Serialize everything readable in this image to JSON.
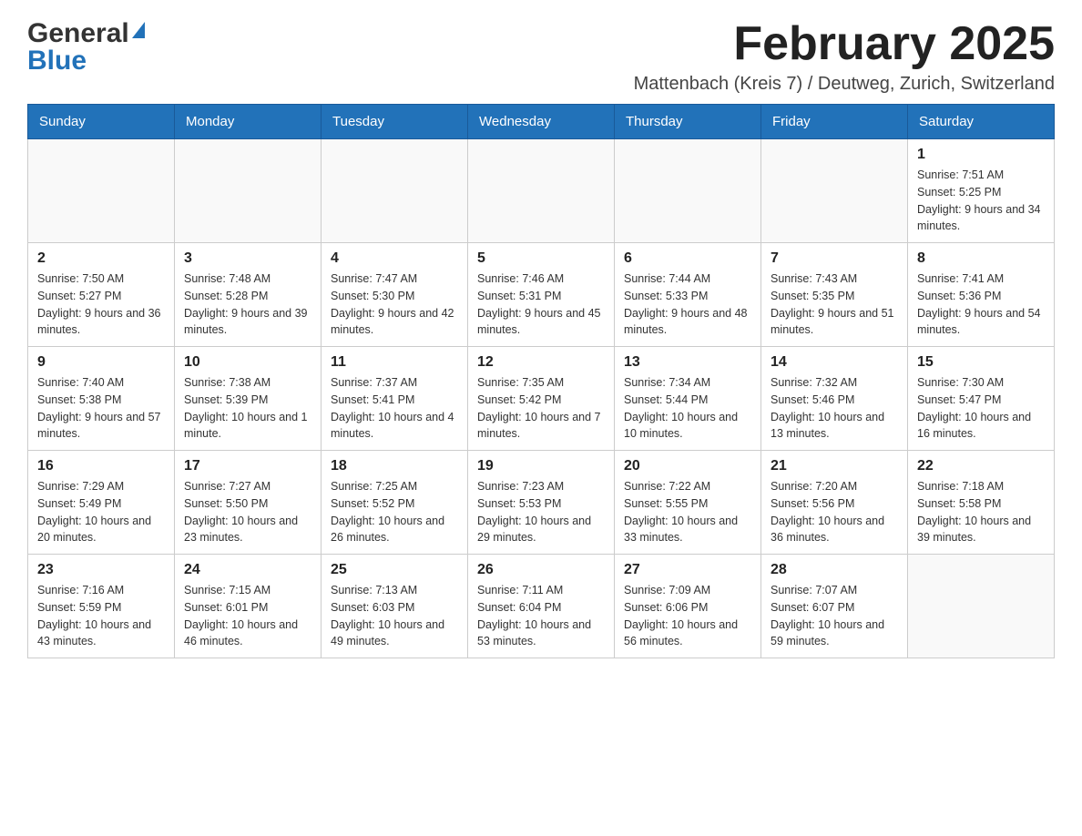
{
  "header": {
    "logo_general": "General",
    "logo_blue": "Blue",
    "month_title": "February 2025",
    "location": "Mattenbach (Kreis 7) / Deutweg, Zurich, Switzerland"
  },
  "weekdays": [
    "Sunday",
    "Monday",
    "Tuesday",
    "Wednesday",
    "Thursday",
    "Friday",
    "Saturday"
  ],
  "weeks": [
    [
      {
        "day": "",
        "info": ""
      },
      {
        "day": "",
        "info": ""
      },
      {
        "day": "",
        "info": ""
      },
      {
        "day": "",
        "info": ""
      },
      {
        "day": "",
        "info": ""
      },
      {
        "day": "",
        "info": ""
      },
      {
        "day": "1",
        "info": "Sunrise: 7:51 AM\nSunset: 5:25 PM\nDaylight: 9 hours and 34 minutes."
      }
    ],
    [
      {
        "day": "2",
        "info": "Sunrise: 7:50 AM\nSunset: 5:27 PM\nDaylight: 9 hours and 36 minutes."
      },
      {
        "day": "3",
        "info": "Sunrise: 7:48 AM\nSunset: 5:28 PM\nDaylight: 9 hours and 39 minutes."
      },
      {
        "day": "4",
        "info": "Sunrise: 7:47 AM\nSunset: 5:30 PM\nDaylight: 9 hours and 42 minutes."
      },
      {
        "day": "5",
        "info": "Sunrise: 7:46 AM\nSunset: 5:31 PM\nDaylight: 9 hours and 45 minutes."
      },
      {
        "day": "6",
        "info": "Sunrise: 7:44 AM\nSunset: 5:33 PM\nDaylight: 9 hours and 48 minutes."
      },
      {
        "day": "7",
        "info": "Sunrise: 7:43 AM\nSunset: 5:35 PM\nDaylight: 9 hours and 51 minutes."
      },
      {
        "day": "8",
        "info": "Sunrise: 7:41 AM\nSunset: 5:36 PM\nDaylight: 9 hours and 54 minutes."
      }
    ],
    [
      {
        "day": "9",
        "info": "Sunrise: 7:40 AM\nSunset: 5:38 PM\nDaylight: 9 hours and 57 minutes."
      },
      {
        "day": "10",
        "info": "Sunrise: 7:38 AM\nSunset: 5:39 PM\nDaylight: 10 hours and 1 minute."
      },
      {
        "day": "11",
        "info": "Sunrise: 7:37 AM\nSunset: 5:41 PM\nDaylight: 10 hours and 4 minutes."
      },
      {
        "day": "12",
        "info": "Sunrise: 7:35 AM\nSunset: 5:42 PM\nDaylight: 10 hours and 7 minutes."
      },
      {
        "day": "13",
        "info": "Sunrise: 7:34 AM\nSunset: 5:44 PM\nDaylight: 10 hours and 10 minutes."
      },
      {
        "day": "14",
        "info": "Sunrise: 7:32 AM\nSunset: 5:46 PM\nDaylight: 10 hours and 13 minutes."
      },
      {
        "day": "15",
        "info": "Sunrise: 7:30 AM\nSunset: 5:47 PM\nDaylight: 10 hours and 16 minutes."
      }
    ],
    [
      {
        "day": "16",
        "info": "Sunrise: 7:29 AM\nSunset: 5:49 PM\nDaylight: 10 hours and 20 minutes."
      },
      {
        "day": "17",
        "info": "Sunrise: 7:27 AM\nSunset: 5:50 PM\nDaylight: 10 hours and 23 minutes."
      },
      {
        "day": "18",
        "info": "Sunrise: 7:25 AM\nSunset: 5:52 PM\nDaylight: 10 hours and 26 minutes."
      },
      {
        "day": "19",
        "info": "Sunrise: 7:23 AM\nSunset: 5:53 PM\nDaylight: 10 hours and 29 minutes."
      },
      {
        "day": "20",
        "info": "Sunrise: 7:22 AM\nSunset: 5:55 PM\nDaylight: 10 hours and 33 minutes."
      },
      {
        "day": "21",
        "info": "Sunrise: 7:20 AM\nSunset: 5:56 PM\nDaylight: 10 hours and 36 minutes."
      },
      {
        "day": "22",
        "info": "Sunrise: 7:18 AM\nSunset: 5:58 PM\nDaylight: 10 hours and 39 minutes."
      }
    ],
    [
      {
        "day": "23",
        "info": "Sunrise: 7:16 AM\nSunset: 5:59 PM\nDaylight: 10 hours and 43 minutes."
      },
      {
        "day": "24",
        "info": "Sunrise: 7:15 AM\nSunset: 6:01 PM\nDaylight: 10 hours and 46 minutes."
      },
      {
        "day": "25",
        "info": "Sunrise: 7:13 AM\nSunset: 6:03 PM\nDaylight: 10 hours and 49 minutes."
      },
      {
        "day": "26",
        "info": "Sunrise: 7:11 AM\nSunset: 6:04 PM\nDaylight: 10 hours and 53 minutes."
      },
      {
        "day": "27",
        "info": "Sunrise: 7:09 AM\nSunset: 6:06 PM\nDaylight: 10 hours and 56 minutes."
      },
      {
        "day": "28",
        "info": "Sunrise: 7:07 AM\nSunset: 6:07 PM\nDaylight: 10 hours and 59 minutes."
      },
      {
        "day": "",
        "info": ""
      }
    ]
  ],
  "colors": {
    "header_bg": "#2272b9",
    "header_text": "#ffffff",
    "border": "#cccccc",
    "empty_bg": "#f9f9f9"
  }
}
